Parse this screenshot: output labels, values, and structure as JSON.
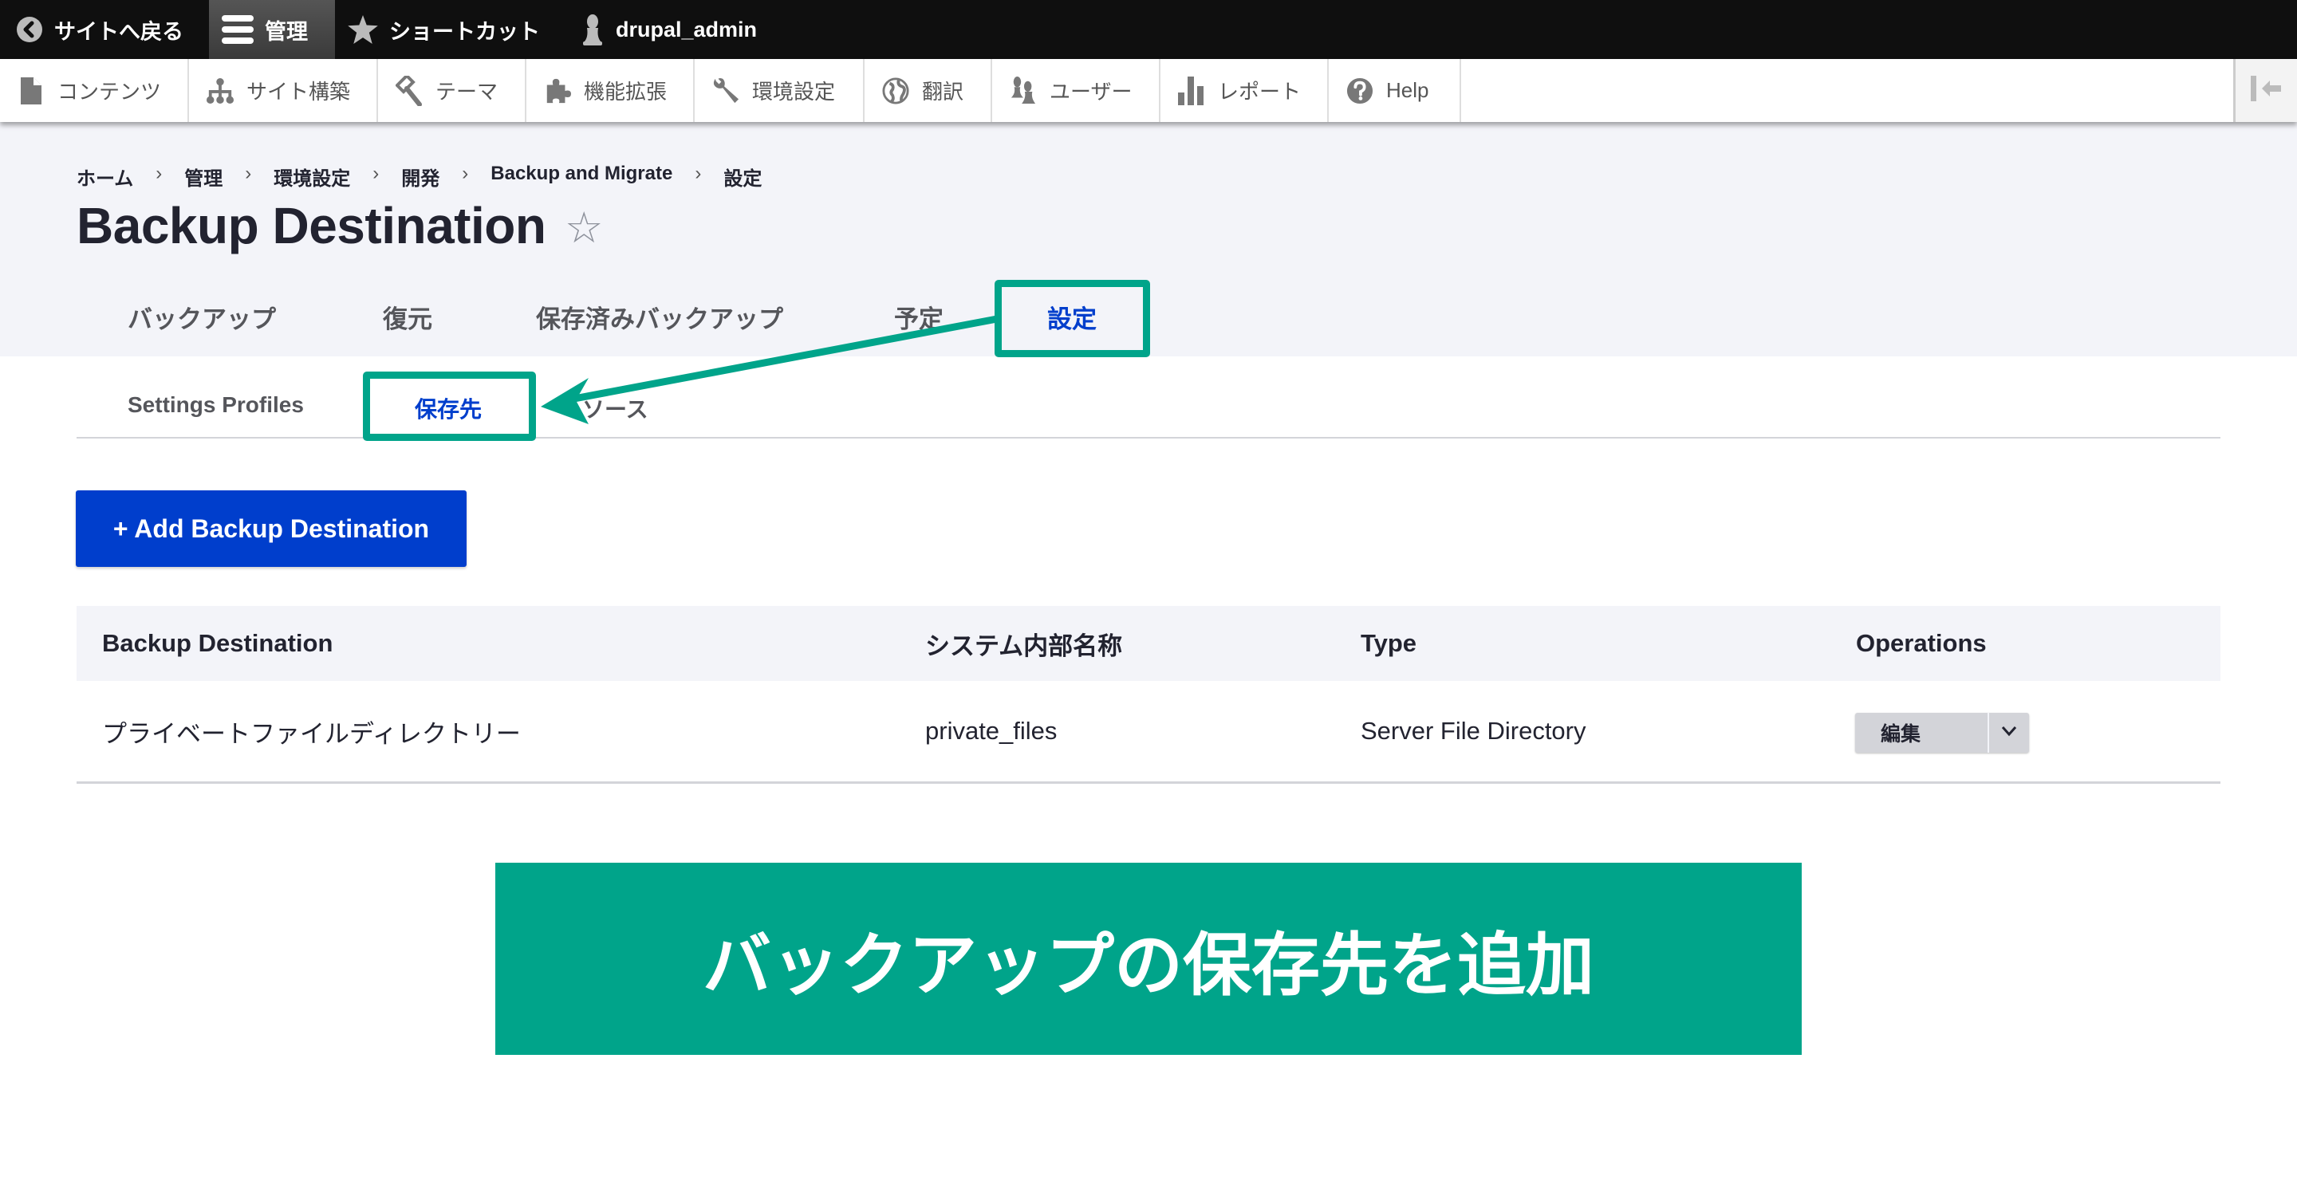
{
  "toolbar": {
    "back_to_site": "サイトへ戻る",
    "manage": "管理",
    "shortcuts": "ショートカット",
    "user": "drupal_admin"
  },
  "admin_menu": {
    "items": [
      {
        "label": "コンテンツ",
        "icon": "file-icon"
      },
      {
        "label": "サイト構築",
        "icon": "sitemap-icon"
      },
      {
        "label": "テーマ",
        "icon": "paintbrush-icon"
      },
      {
        "label": "機能拡張",
        "icon": "puzzle-icon"
      },
      {
        "label": "環境設定",
        "icon": "wrench-icon"
      },
      {
        "label": "翻訳",
        "icon": "globe-icon"
      },
      {
        "label": "ユーザー",
        "icon": "users-icon"
      },
      {
        "label": "レポート",
        "icon": "bar-chart-icon"
      },
      {
        "label": "Help",
        "icon": "help-icon"
      }
    ]
  },
  "breadcrumb": {
    "items": [
      "ホーム",
      "管理",
      "環境設定",
      "開発",
      "Backup and Migrate",
      "設定"
    ],
    "separator": "›"
  },
  "page": {
    "title": "Backup Destination",
    "favorite_star": "☆"
  },
  "primary_tabs": [
    {
      "label": "バックアップ",
      "active": false
    },
    {
      "label": "復元",
      "active": false
    },
    {
      "label": "保存済みバックアップ",
      "active": false
    },
    {
      "label": "予定",
      "active": false
    },
    {
      "label": "設定",
      "active": true
    }
  ],
  "secondary_tabs": [
    {
      "label": "Settings Profiles",
      "active": false
    },
    {
      "label": "保存先",
      "active": true
    },
    {
      "label": "ソース",
      "active": false
    }
  ],
  "actions": {
    "add_button": "+ Add Backup Destination"
  },
  "table": {
    "headers": [
      "Backup Destination",
      "システム内部名称",
      "Type",
      "Operations"
    ],
    "rows": [
      {
        "name": "プライベートファイルディレクトリー",
        "machine_name": "private_files",
        "type": "Server File Directory",
        "operation": "編集"
      }
    ]
  },
  "annotation": {
    "banner_text": "バックアップの保存先を追加",
    "color": "#00a48a"
  },
  "colors": {
    "accent_blue": "#003ecc",
    "toolbar_bg": "#0f0f0f",
    "header_bg": "#f3f4f9"
  }
}
